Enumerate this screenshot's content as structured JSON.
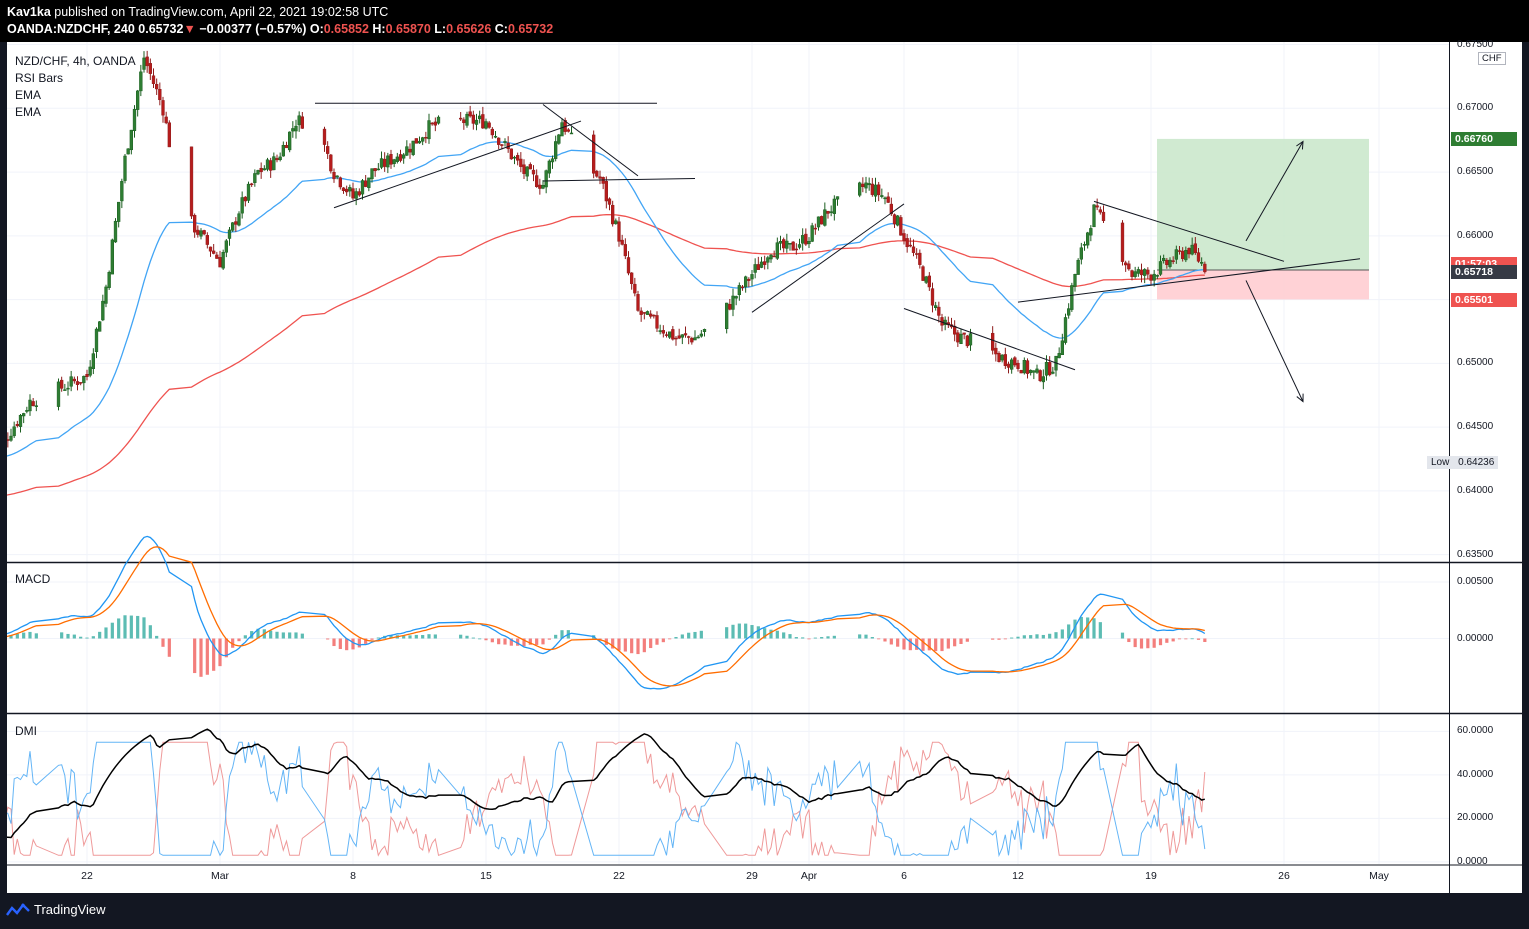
{
  "header": {
    "author": "Kav1ka",
    "published_text": "published on TradingView.com, April 22, 2021 19:02:58 UTC",
    "symbol": "OANDA:NZDCHF, 240",
    "last_price": "0.65732",
    "change_arrow": "▼",
    "change": "−0.00377 (−0.57%)",
    "open_label": "O:",
    "open": "0.65852",
    "high_label": "H:",
    "high": "0.65870",
    "low_label": "L:",
    "low": "0.65626",
    "close_label": "C:",
    "close": "0.65732"
  },
  "legend": {
    "title": "NZD/CHF, 4h, OANDA",
    "rsi": "RSI Bars",
    "ema1": "EMA",
    "ema2": "EMA",
    "macd": "MACD",
    "dmi": "DMI"
  },
  "currency_button": "CHF",
  "low_marker": {
    "label": "Low",
    "value": "0.64236"
  },
  "price_tags": {
    "target": "0.66760",
    "countdown": "01:57:03",
    "current": "0.65718",
    "stop": "0.65501"
  },
  "footer": {
    "brand": "TradingView"
  },
  "colors": {
    "up": "#1b5e20",
    "down": "#8e1c1c",
    "ema_fast": "#42a5f5",
    "ema_slow": "#ef5350",
    "macd_line": "#2196f3",
    "signal_line": "#ff6d00",
    "dmi_adx": "#000000",
    "dmi_plus": "#64b5f6",
    "dmi_minus": "#ef9a9a",
    "target_zone": "#c8e6c9",
    "stop_zone": "#ffcdd2"
  },
  "chart_data": [
    {
      "type": "candlestick",
      "title": "NZD/CHF, 4h, OANDA",
      "x_ticks": [
        "22",
        "Mar",
        "8",
        "15",
        "22",
        "29",
        "Apr",
        "6",
        "12",
        "19",
        "26",
        "May"
      ],
      "y_ticks": [
        "0.67500",
        "0.67000",
        "0.66500",
        "0.66000",
        "0.65500",
        "0.65000",
        "0.64500",
        "0.64000",
        "0.63500"
      ],
      "ylim": [
        0.6345,
        0.6752
      ],
      "close_path": [
        [
          "Feb 17",
          0.6425
        ],
        [
          "Feb 19",
          0.647
        ],
        [
          "Feb 22",
          0.649
        ],
        [
          "Feb 23",
          0.656
        ],
        [
          "Feb 24",
          0.666
        ],
        [
          "Feb 25",
          0.674
        ],
        [
          "Feb 26",
          0.67
        ],
        [
          "Feb 27",
          0.662
        ],
        [
          "Mar 1",
          0.658
        ],
        [
          "Mar 2",
          0.662
        ],
        [
          "Mar 3",
          0.665
        ],
        [
          "Mar 4",
          0.666
        ],
        [
          "Mar 5",
          0.669
        ],
        [
          "Mar 6",
          0.669
        ],
        [
          "Mar 7",
          0.665
        ],
        [
          "Mar 8",
          0.663
        ],
        [
          "Mar 9",
          0.665
        ],
        [
          "Mar 10",
          0.666
        ],
        [
          "Mar 11",
          0.667
        ],
        [
          "Mar 12",
          0.6685
        ],
        [
          "Mar 13",
          0.669
        ],
        [
          "Mar 15",
          0.669
        ],
        [
          "Mar 16",
          0.667
        ],
        [
          "Mar 17",
          0.665
        ],
        [
          "Mar 18",
          0.664
        ],
        [
          "Mar 19",
          0.669
        ],
        [
          "Mar 20",
          0.666
        ],
        [
          "Mar 21",
          0.6645
        ],
        [
          "Mar 22",
          0.66
        ],
        [
          "Mar 23",
          0.654
        ],
        [
          "Mar 24",
          0.653
        ],
        [
          "Mar 25",
          0.652
        ],
        [
          "Mar 26",
          0.652
        ],
        [
          "Mar 27",
          0.653
        ],
        [
          "Mar 29",
          0.657
        ],
        [
          "Mar 30",
          0.659
        ],
        [
          "Mar 31",
          0.659
        ],
        [
          "Apr 1",
          0.66
        ],
        [
          "Apr 2",
          0.662
        ],
        [
          "Apr 3",
          0.663
        ],
        [
          "Apr 4",
          0.664
        ],
        [
          "Apr 5",
          0.663
        ],
        [
          "Apr 6",
          0.66
        ],
        [
          "Apr 7",
          0.657
        ],
        [
          "Apr 8",
          0.653
        ],
        [
          "Apr 9",
          0.652
        ],
        [
          "Apr 10",
          0.6515
        ],
        [
          "Apr 11",
          0.6505
        ],
        [
          "Apr 12",
          0.65
        ],
        [
          "Apr 13",
          0.649
        ],
        [
          "Apr 14",
          0.65
        ],
        [
          "Apr 15",
          0.657
        ],
        [
          "Apr 16",
          0.662
        ],
        [
          "Apr 17",
          0.66
        ],
        [
          "Apr 18",
          0.657
        ],
        [
          "Apr 19",
          0.657
        ],
        [
          "Apr 20",
          0.658
        ],
        [
          "Apr 21",
          0.659
        ],
        [
          "Apr 22",
          0.6573
        ]
      ],
      "trade_setup": {
        "entry": 0.65732,
        "target": 0.6676,
        "stop": 0.65501
      },
      "lowest_value": 0.64236
    },
    {
      "type": "line",
      "title": "MACD",
      "y_ticks": [
        "0.00500",
        "0.00000"
      ],
      "ylim": [
        -0.0065,
        0.0065
      ],
      "series": []
    },
    {
      "type": "line",
      "title": "DMI",
      "y_ticks": [
        "60.0000",
        "40.0000",
        "20.0000",
        "0.0000"
      ],
      "ylim": [
        -1,
        68
      ],
      "series": []
    }
  ]
}
